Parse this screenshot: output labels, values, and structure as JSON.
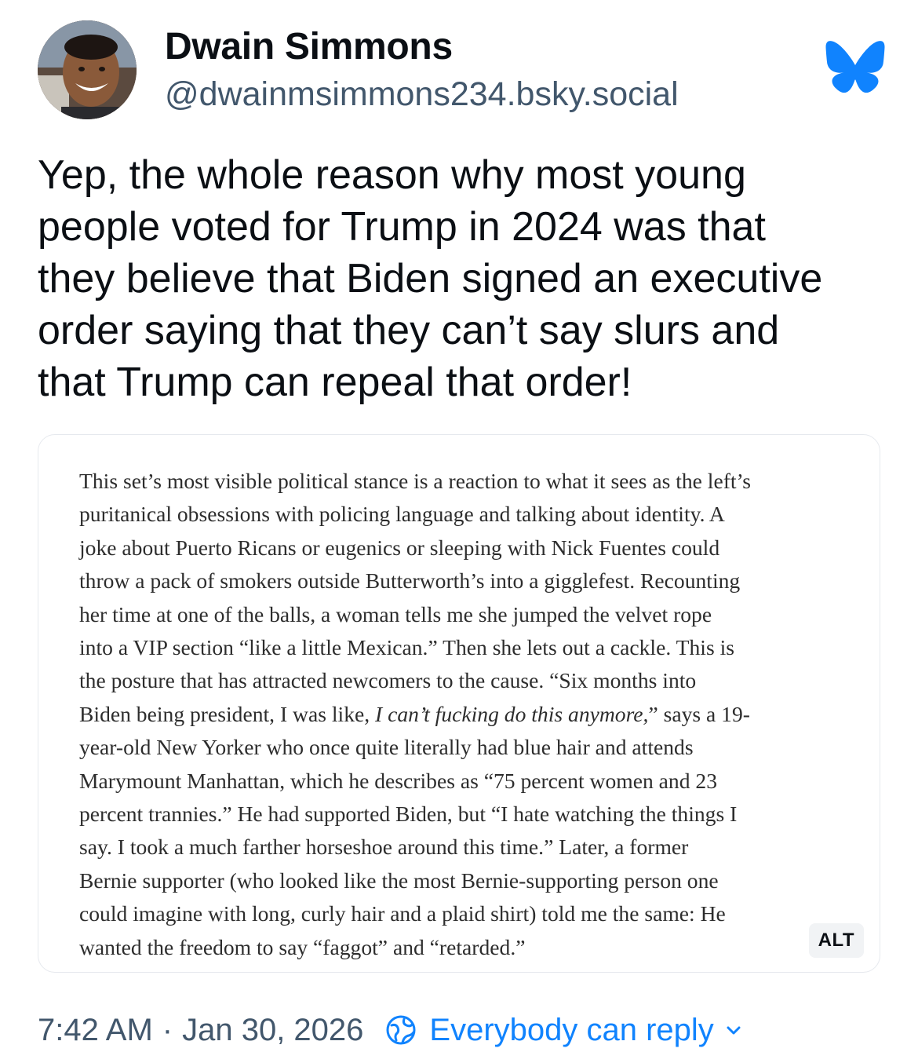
{
  "author": {
    "name": "Dwain Simmons",
    "handle": "@dwainmsimmons234.bsky.social"
  },
  "post": {
    "text": "Yep, the whole reason why most young\npeople voted for Trump in 2024 was that\nthey believe that Biden signed an executive\norder saying that they can’t say slurs and\nthat Trump can repeal that order!"
  },
  "image": {
    "quote_lines": [
      "This set’s most visible political stance is a reaction to what it sees as the left’s",
      "puritanical obsessions with policing language and talking about identity. A",
      "joke about Puerto Ricans or eugenics or sleeping with Nick Fuentes could",
      "throw a pack of smokers outside Butterworth’s into a gigglefest. Recounting",
      "her time at one of the balls, a woman tells me she jumped the velvet rope",
      "into a VIP section “like a little Mexican.” Then she lets out a cackle. This is",
      "the posture that has attracted newcomers to the cause. “Six months into",
      "year-old New Yorker who once quite literally had blue hair and attends",
      "Marymount Manhattan, which he describes as “75 percent women and 23",
      "percent trannies.” He had supported Biden, but “I hate watching the things I",
      "say. I took a much farther horseshoe around this time.” Later, a former",
      "Bernie supporter (who looked like the most Bernie-supporting person one",
      "could imagine with long, curly hair and a plaid shirt) told me the same: He",
      "wanted the freedom to say “faggot” and “retarded.”"
    ],
    "biden_line": {
      "before": "Biden being president, I was like, ",
      "italic": "I can’t fucking do this anymore,",
      "after": "” says a 19-"
    },
    "alt_label": "ALT"
  },
  "footer": {
    "time": "7:42 AM",
    "separator": "·",
    "date": "Jan 30, 2026",
    "reply_setting": "Everybody can reply"
  },
  "icons": {
    "bluesky": "butterfly-icon",
    "reply": "globe-icon",
    "chevron": "chevron-down-icon"
  },
  "colors": {
    "accent": "#1083fe",
    "muted": "#42576c"
  }
}
